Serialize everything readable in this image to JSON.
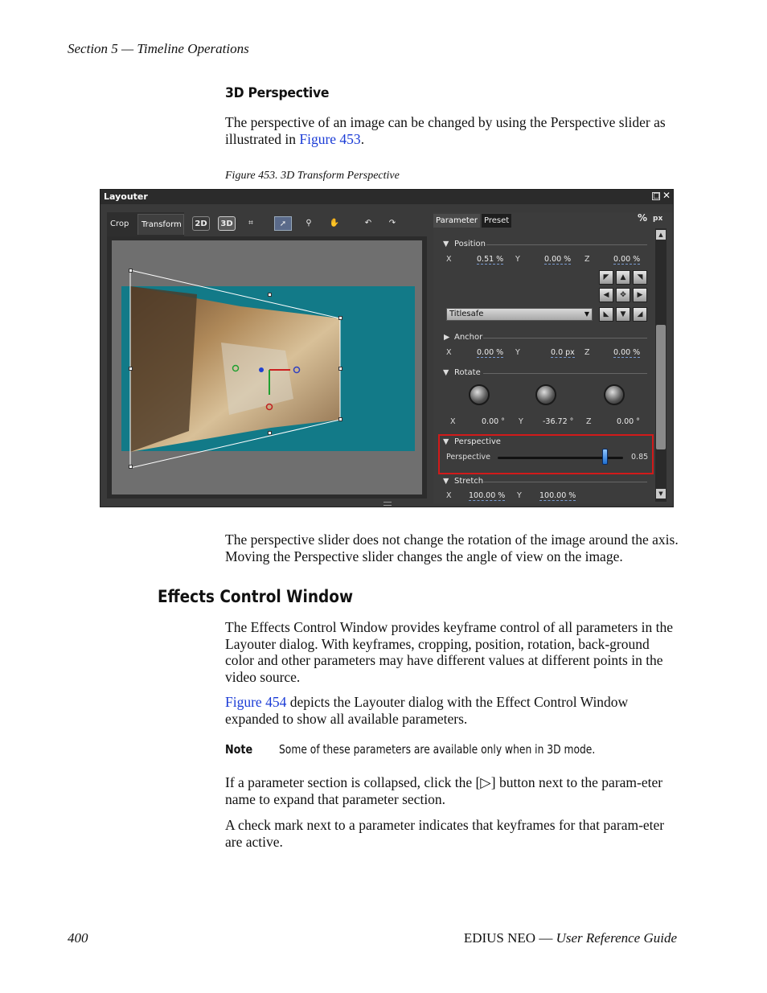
{
  "page": {
    "header": "Section 5 — Timeline Operations",
    "heading_3d": "3D Perspective",
    "intro_before_link": "The perspective of an image can be changed by using the Perspective slider as illustrated in ",
    "intro_link": "Figure 453",
    "intro_after_link": ".",
    "caption": "Figure 453.  3D Transform Perspective",
    "after_figure": "The perspective slider does not change the rotation of the image around the axis. Moving the Perspective slider changes the angle of view on the image.",
    "heading_effects": "Effects Control Window",
    "effects_para_1": "The Effects Control Window provides keyframe control of all parameters in the Layouter dialog. With keyframes, cropping, position, rotation, back-ground color and other parameters may have different values at different points in the video source.",
    "effects_link": "Figure 454",
    "effects_para_2_rest": " depicts the Layouter dialog with the Effect Control Window expanded to show all available parameters.",
    "note_label": "Note",
    "note_text": "Some of these parameters are available only when in 3D mode.",
    "collapsed_para": "If a parameter section is collapsed, click the [▷] button next to the param-eter name to expand that parameter section.",
    "checkmark_para": "A check mark next to a parameter indicates that keyframes for that param-eter are active.",
    "footer_page": "400",
    "footer_product": "EDIUS NEO",
    "footer_sep": " — ",
    "footer_guide": "User Reference Guide"
  },
  "screenshot": {
    "title": "Layouter",
    "tabs": [
      "Crop",
      "Transform"
    ],
    "toolbar": {
      "btn_2d": "2D",
      "btn_3d": "3D"
    },
    "panel_tabs": [
      "Parameter",
      "Preset"
    ],
    "units": {
      "percent": "%",
      "px": "px"
    },
    "position": {
      "label": "Position",
      "x_label": "X",
      "x_value": "0.51 %",
      "y_label": "Y",
      "y_value": "0.00 %",
      "z_label": "Z",
      "z_value": "0.00 %"
    },
    "titlesafe": "Titlesafe",
    "anchor": {
      "label": "Anchor",
      "x_label": "X",
      "x_value": "0.00 %",
      "y_label": "Y",
      "y_value": "0.0 px",
      "z_label": "Z",
      "z_value": "0.00 %"
    },
    "rotate": {
      "label": "Rotate",
      "x_label": "X",
      "x_value": "0.00 °",
      "y_label": "Y",
      "y_value": "-36.72 °",
      "z_label": "Z",
      "z_value": "0.00 °"
    },
    "perspective": {
      "label": "Perspective",
      "slider_label": "Perspective",
      "value": "0.85",
      "fraction": 0.85
    },
    "stretch": {
      "label": "Stretch",
      "x_label": "X",
      "x_value": "100.00 %",
      "y_label": "Y",
      "y_value": "100.00 %"
    }
  }
}
